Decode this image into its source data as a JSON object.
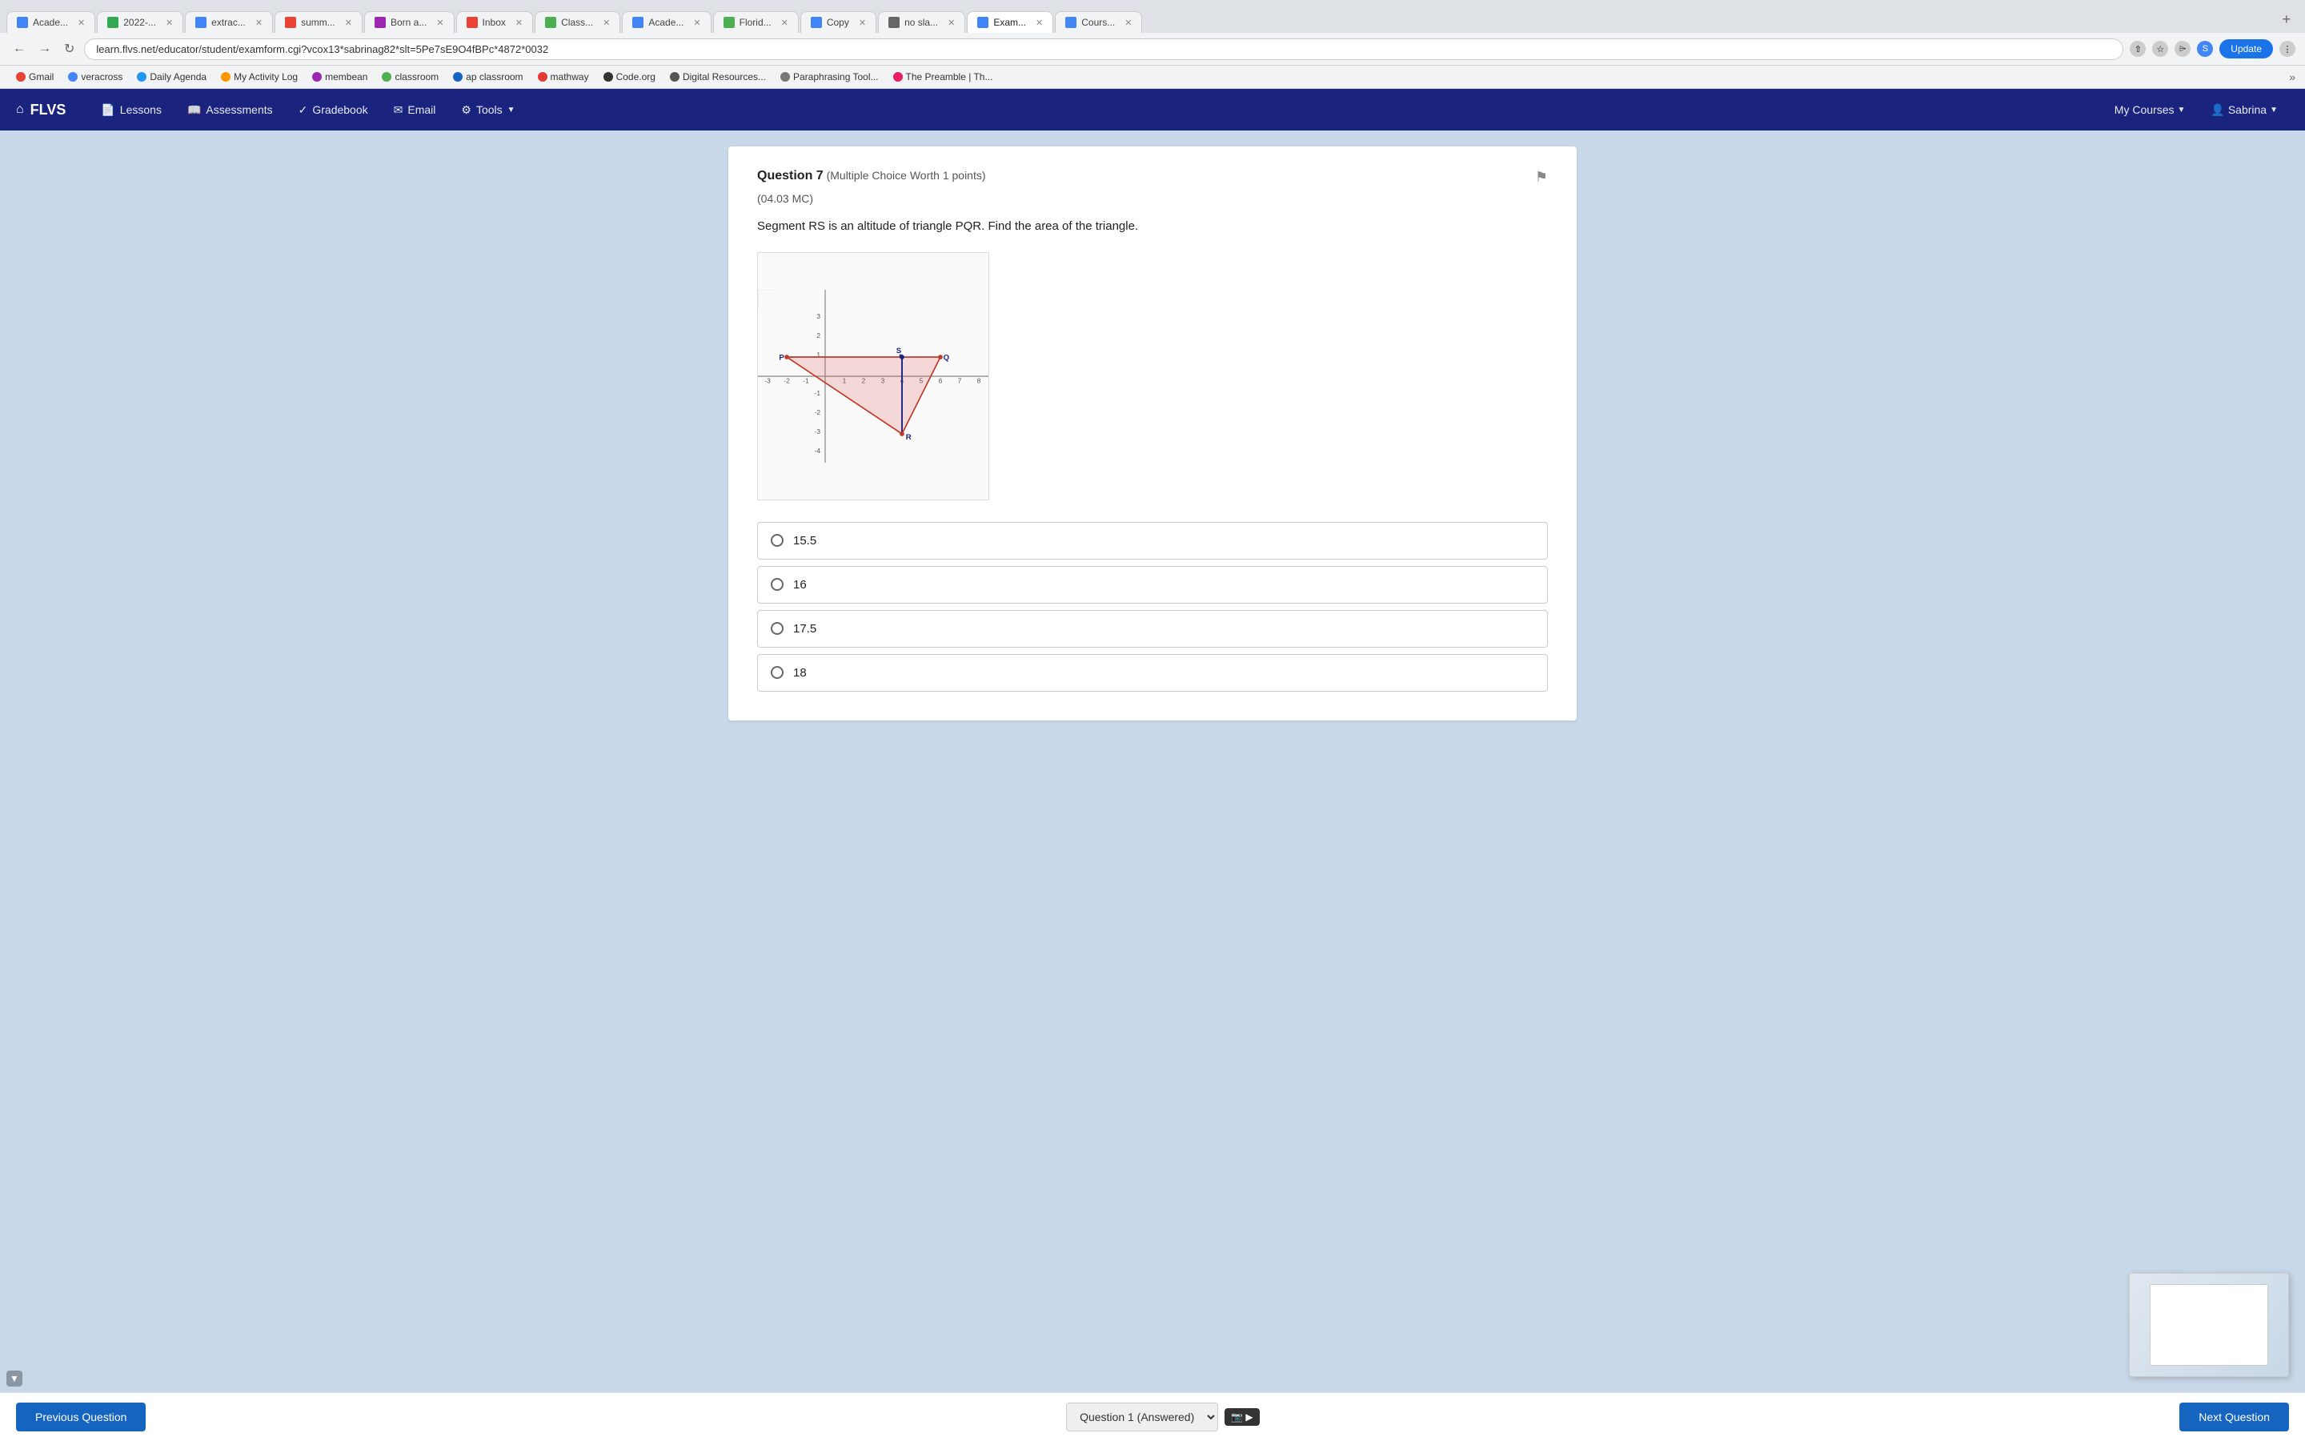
{
  "browser": {
    "address": "learn.flvs.net/educator/student/examform.cgi?vcox13*sabrinag82*slt=5Pe7sE9O4fBPc*4872*0032",
    "update_label": "Update",
    "tabs": [
      {
        "label": "Acade...",
        "active": false,
        "color": "#4285f4"
      },
      {
        "label": "2022-...",
        "active": false,
        "color": "#34a853"
      },
      {
        "label": "extrac...",
        "active": false,
        "color": "#4285f4"
      },
      {
        "label": "summ...",
        "active": false,
        "color": "#ea4335"
      },
      {
        "label": "Born a...",
        "active": false,
        "color": "#9c27b0"
      },
      {
        "label": "Inbox",
        "active": false,
        "color": "#ea4335"
      },
      {
        "label": "Class...",
        "active": false,
        "color": "#4caf50"
      },
      {
        "label": "Acade...",
        "active": false,
        "color": "#4285f4"
      },
      {
        "label": "Florid...",
        "active": false,
        "color": "#4caf50"
      },
      {
        "label": "Copy",
        "active": false,
        "color": "#4285f4"
      },
      {
        "label": "no sla...",
        "active": false,
        "color": "#666"
      },
      {
        "label": "Exam...",
        "active": true,
        "color": "#4285f4"
      },
      {
        "label": "Cours...",
        "active": false,
        "color": "#4285f4"
      }
    ]
  },
  "bookmarks": {
    "items": [
      {
        "label": "Gmail",
        "color": "#ea4335"
      },
      {
        "label": "veracross",
        "color": "#4285f4"
      },
      {
        "label": "Daily Agenda",
        "color": "#2196f3"
      },
      {
        "label": "My Activity Log",
        "color": "#ff9800"
      },
      {
        "label": "membean",
        "color": "#9c27b0"
      },
      {
        "label": "classroom",
        "color": "#4caf50"
      },
      {
        "label": "ap classroom",
        "color": "#1565c0"
      },
      {
        "label": "mathway",
        "color": "#e53935"
      },
      {
        "label": "Code.org",
        "color": "#333"
      },
      {
        "label": "Digital Resources...",
        "color": "#555"
      },
      {
        "label": "Paraphrasing Tool...",
        "color": "#777"
      },
      {
        "label": "The Preamble | Th...",
        "color": "#e91e63"
      }
    ]
  },
  "nav": {
    "brand": "FLVS",
    "lessons_label": "Lessons",
    "assessments_label": "Assessments",
    "gradebook_label": "Gradebook",
    "email_label": "Email",
    "tools_label": "Tools",
    "my_courses_label": "My Courses",
    "user_label": "Sabrina"
  },
  "question": {
    "number": "Question 7",
    "type": "(Multiple Choice Worth 1 points)",
    "code": "(04.03 MC)",
    "text": "Segment RS is an altitude of triangle PQR. Find the area of the triangle.",
    "choices": [
      {
        "value": "15.5",
        "id": "a"
      },
      {
        "value": "16",
        "id": "b"
      },
      {
        "value": "17.5",
        "id": "c"
      },
      {
        "value": "18",
        "id": "d"
      }
    ]
  },
  "navigation": {
    "prev_label": "Previous Question",
    "next_label": "Next Question",
    "select_label": "Question 1 (Answered)"
  }
}
